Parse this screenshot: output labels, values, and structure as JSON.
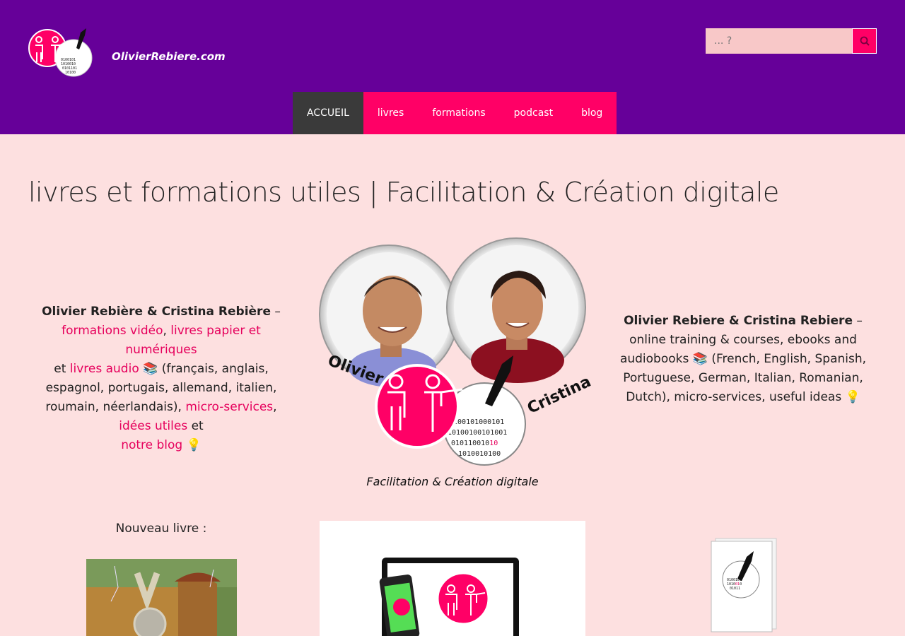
{
  "header": {
    "site_title": "OlivierRebiere.com",
    "search_placeholder": "... ?",
    "search_icon": "search-icon"
  },
  "nav": {
    "items": [
      {
        "label": "ACCUEIL",
        "active": true
      },
      {
        "label": "livres"
      },
      {
        "label": "formations"
      },
      {
        "label": "podcast"
      },
      {
        "label": "blog"
      }
    ]
  },
  "main": {
    "title": "livres et formations utiles | Facilitation & Création digitale",
    "left": {
      "names": "Olivier Rebière & Cristina Rebière",
      "dash": " –",
      "link_videos": "formations vidéo",
      "sep1": ", ",
      "link_books": "livres papier et numériques",
      "et1": "et ",
      "link_audio": "livres audio",
      "books_emoji": "📚",
      "languages": " (français, anglais, espagnol, portugais, allemand, italien, roumain, néerlandais), ",
      "link_micro": "micro-services",
      "sep2": ", ",
      "link_ideas": "idées utiles",
      "et2": " et ",
      "link_blog": "notre blog",
      "bulb_emoji": "💡"
    },
    "right": {
      "names": "Olivier Rebiere & Cristina Rebiere",
      "text": " – online training & courses, ebooks and audiobooks ",
      "books_emoji": "📚",
      "text2": " (French, English, Spanish, Portuguese, German, Italian, Romanian, Dutch), micro-services, useful ideas ",
      "bulb_emoji": "💡"
    },
    "hero": {
      "name_left": "Olivier",
      "name_right": "Cristina",
      "tagline": "Facilitation & Création digitale"
    },
    "new_book_label": "Nouveau livre :"
  },
  "colors": {
    "header_bg": "#660099",
    "accent": "#ff0066",
    "page_bg": "#fde0e0",
    "nav_active": "#3a3a3a"
  }
}
